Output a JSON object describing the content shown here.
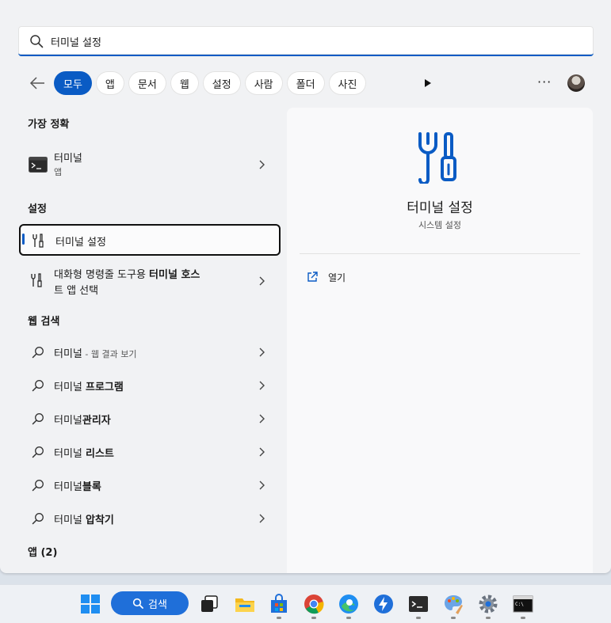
{
  "search": {
    "query": "터미널 설정"
  },
  "filters": [
    "모두",
    "앱",
    "문서",
    "웹",
    "설정",
    "사람",
    "폴더",
    "사진"
  ],
  "left": {
    "best_match": {
      "heading": "가장 정확",
      "item": {
        "title": "터미널",
        "type": "앱"
      }
    },
    "settings": {
      "heading": "설정",
      "items": [
        {
          "title": "터미널 설정"
        },
        {
          "title_line1_pre": "대화형 명령줄 도구용 ",
          "title_line1_bold": "터미널 호스",
          "title_line2": "트 앱 선택"
        }
      ]
    },
    "web": {
      "heading": "웹 검색",
      "items": [
        {
          "pre": "터미널",
          "bold": "",
          "suffix": " - 웹 결과 보기"
        },
        {
          "pre": "터미널 ",
          "bold": "프로그램",
          "suffix": ""
        },
        {
          "pre": "터미널",
          "bold": "관리자",
          "suffix": ""
        },
        {
          "pre": "터미널 ",
          "bold": "리스트",
          "suffix": ""
        },
        {
          "pre": "터미널",
          "bold": "블록",
          "suffix": ""
        },
        {
          "pre": "터미널 ",
          "bold": "압착기",
          "suffix": ""
        }
      ]
    },
    "apps_heading": "앱 (2)"
  },
  "detail": {
    "title": "터미널 설정",
    "subtitle": "시스템 설정",
    "action_open": "열기"
  },
  "taskbar": {
    "search_label": "검색"
  },
  "colors": {
    "accent": "#0a5bc4",
    "panel": "#f1f2f4"
  }
}
